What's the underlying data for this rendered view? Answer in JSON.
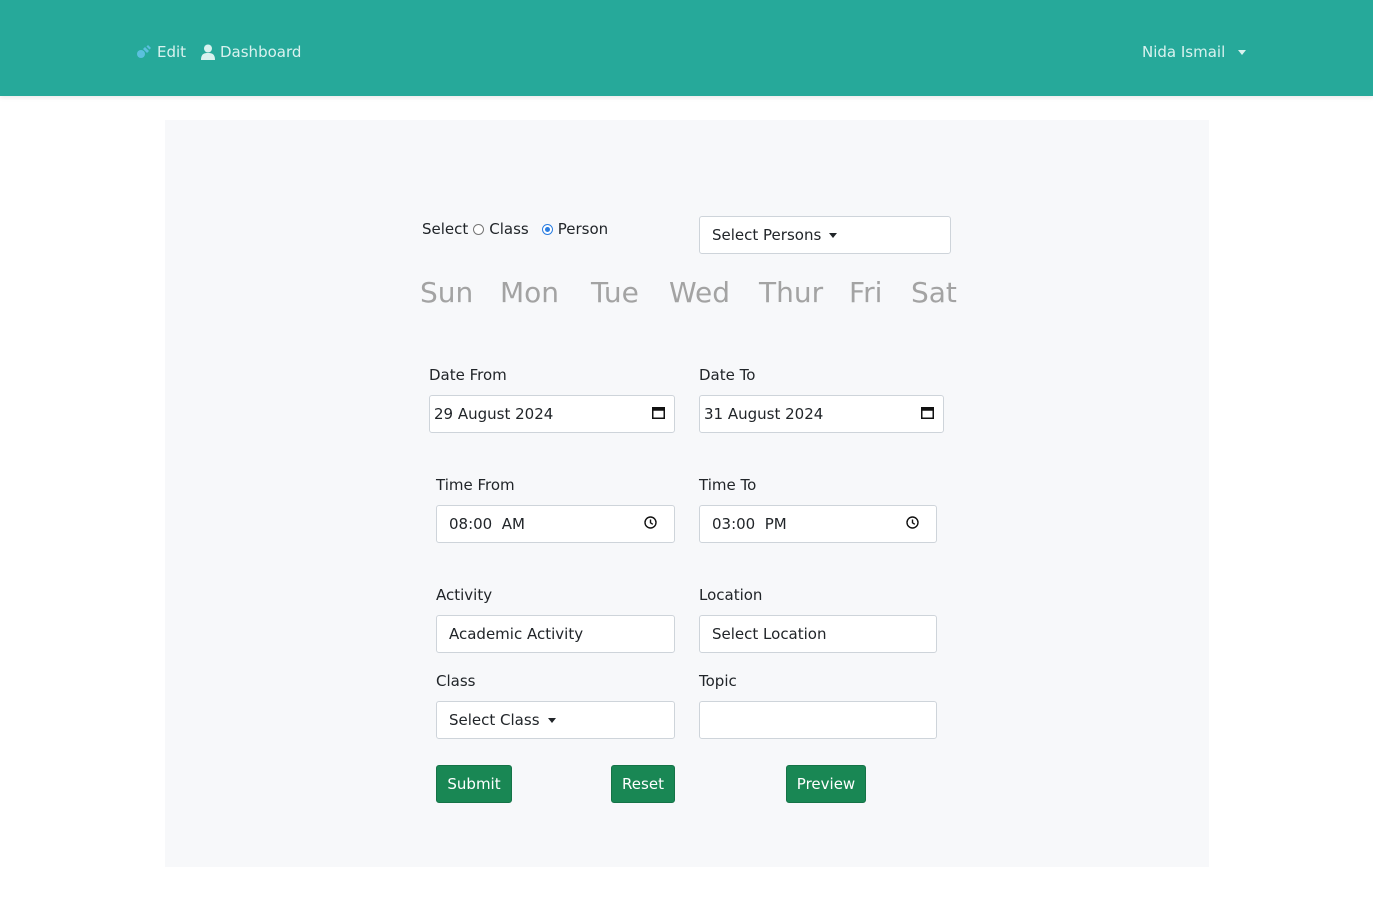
{
  "nav": {
    "edit_label": "Edit",
    "dashboard_label": "Dashboard",
    "user_name": "Nida Ismail"
  },
  "colors": {
    "topbar": "#26a99a",
    "panel": "#f7f8fa",
    "button": "#198754",
    "days_text": "#a3a3a3"
  },
  "form": {
    "select_label": "Select",
    "radio_class_label": "Class",
    "radio_person_label": "Person",
    "selected_mode": "Person",
    "persons_dropdown": "Select Persons",
    "days": [
      "Sun",
      "Mon",
      "Tue",
      "Wed",
      "Thur",
      "Fri",
      "Sat"
    ],
    "date_from_label": "Date From",
    "date_from_value": "29 August 2024",
    "date_to_label": "Date To",
    "date_to_value": "31 August 2024",
    "time_from_label": "Time From",
    "time_from_value": "08:00  AM",
    "time_to_label": "Time To",
    "time_to_value": "03:00  PM",
    "activity_label": "Activity",
    "activity_value": "Academic Activity",
    "location_label": "Location",
    "location_value": "Select Location",
    "class_label": "Class",
    "class_dropdown": "Select Class",
    "topic_label": "Topic",
    "topic_value": ""
  },
  "buttons": {
    "submit": "Submit",
    "reset": "Reset",
    "preview": "Preview"
  }
}
